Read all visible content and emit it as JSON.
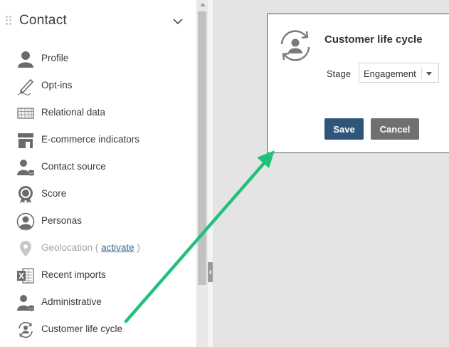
{
  "sidebar": {
    "title": "Contact",
    "items": [
      {
        "label": "Profile",
        "icon": "profile-icon"
      },
      {
        "label": "Opt-ins",
        "icon": "pen-icon"
      },
      {
        "label": "Relational data",
        "icon": "grid-icon"
      },
      {
        "label": "E-commerce indicators",
        "icon": "store-icon"
      },
      {
        "label": "Contact source",
        "icon": "contact-source-icon"
      },
      {
        "label": "Score",
        "icon": "score-badge-icon"
      },
      {
        "label": "Personas",
        "icon": "persona-icon"
      },
      {
        "label": "Geolocation (",
        "link": "activate",
        "suffix": " )",
        "icon": "location-pin-icon"
      },
      {
        "label": "Recent imports",
        "icon": "excel-import-icon"
      },
      {
        "label": "Administrative",
        "icon": "administrative-icon"
      },
      {
        "label": "Customer life cycle",
        "icon": "life-cycle-icon"
      }
    ]
  },
  "dialog": {
    "title": "Customer life cycle",
    "stage_label": "Stage",
    "stage_value": "Engagement",
    "save_label": "Save",
    "cancel_label": "Cancel"
  },
  "colors": {
    "save_button": "#2f5679",
    "cancel_button": "#707070",
    "annotation_arrow": "#22c17a",
    "link": "#3d6a91"
  }
}
